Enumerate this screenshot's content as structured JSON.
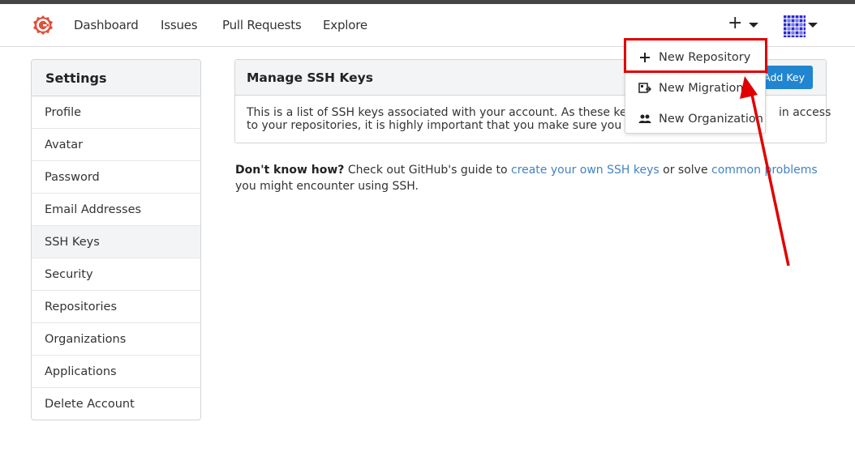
{
  "nav": {
    "items": [
      "Dashboard",
      "Issues",
      "Pull Requests",
      "Explore"
    ],
    "plus_label": "+"
  },
  "sidebar": {
    "title": "Settings",
    "items": [
      "Profile",
      "Avatar",
      "Password",
      "Email Addresses",
      "SSH Keys",
      "Security",
      "Repositories",
      "Organizations",
      "Applications",
      "Delete Account"
    ],
    "active": "SSH Keys"
  },
  "panel": {
    "title": "Manage SSH Keys",
    "add_key_label": "Add Key",
    "line1": "This is a list of SSH keys associated with your account. As these keys allo",
    "line1_tail": "in access",
    "line2": "to your repositories, it is highly important that you make sure you recogn"
  },
  "help": {
    "bold": "Don't know how?",
    "text1": " Check out GitHub's guide to ",
    "link1": "create your own SSH keys",
    "text2": " or solve ",
    "link2": "common problems",
    "text3": " you might encounter using SSH."
  },
  "dropdown": {
    "items": [
      {
        "label": "New Repository",
        "icon": "plus-icon"
      },
      {
        "label": "New Migration",
        "icon": "migration-icon"
      },
      {
        "label": "New Organization",
        "icon": "organization-icon"
      }
    ]
  },
  "colors": {
    "accent": "#2185d0",
    "link": "#4183c4",
    "highlight": "#e00000",
    "logo": "#e0513c"
  }
}
